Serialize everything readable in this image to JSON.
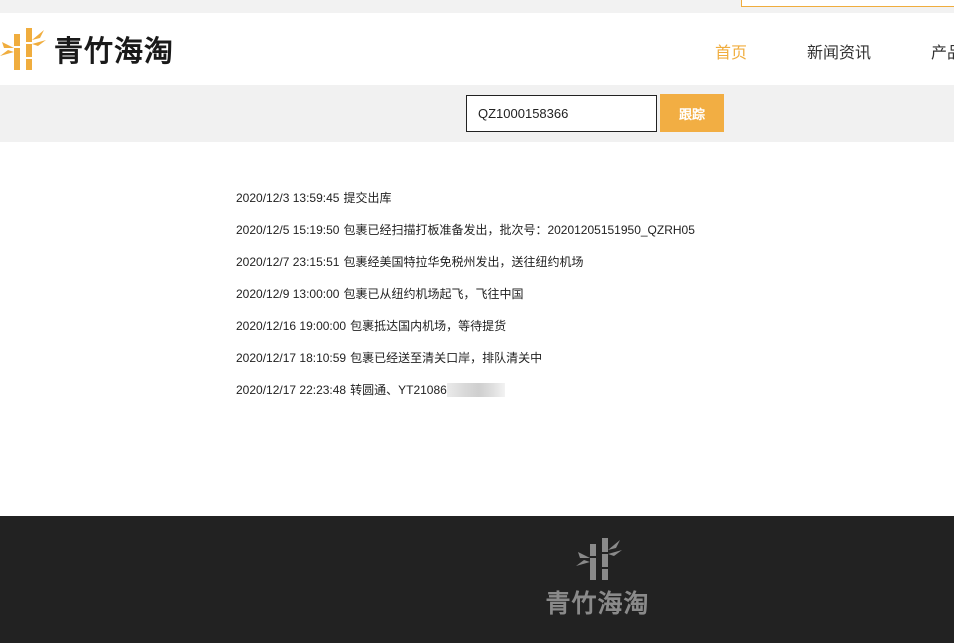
{
  "brand": {
    "name": "青竹海淘",
    "logo_icon": "bamboo-icon",
    "accent_color": "#f0ad3e"
  },
  "nav": {
    "items": [
      {
        "label": "首页",
        "active": true
      },
      {
        "label": "新闻资讯",
        "active": false
      },
      {
        "label": "产品",
        "active": false
      }
    ]
  },
  "search": {
    "value": "QZ1000158366",
    "button_label": "跟踪"
  },
  "tracking": {
    "events": [
      {
        "time": "2020/12/3 13:59:45",
        "text": "提交出库"
      },
      {
        "time": "2020/12/5 15:19:50",
        "text": "包裹已经扫描打板准备发出，批次号：20201205151950_QZRH05"
      },
      {
        "time": "2020/12/7 23:15:51",
        "text": "包裹经美国特拉华免税州发出，送往纽约机场"
      },
      {
        "time": "2020/12/9 13:00:00",
        "text": "包裹已从纽约机场起飞，飞往中国"
      },
      {
        "time": "2020/12/16 19:00:00",
        "text": "包裹抵达国内机场，等待提货"
      },
      {
        "time": "2020/12/17 18:10:59",
        "text": "包裹已经送至清关口岸，排队清关中"
      },
      {
        "time": "2020/12/17 22:23:48",
        "text": "转圆通、YT21086"
      }
    ]
  },
  "footer": {
    "brand_name": "青竹海淘",
    "logo_icon": "bamboo-icon"
  }
}
